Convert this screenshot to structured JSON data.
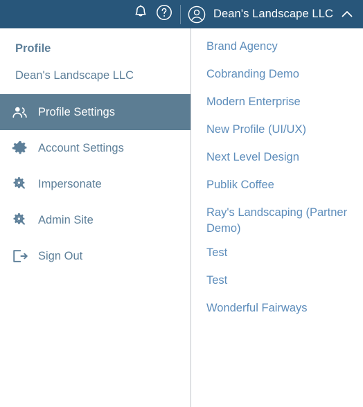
{
  "topbar": {
    "background_color": "#28567a",
    "notifications_icon": "bell-icon",
    "help_icon": "question-circle-icon",
    "avatar_icon": "user-circle-icon",
    "account_name": "Dean's Landscape LLC",
    "chevron_icon": "chevron-up-icon"
  },
  "dropdown": {
    "left_pane": {
      "section_title": "Profile",
      "company_name": "Dean's Landscape LLC",
      "active_color": "#5c7d93",
      "text_color": "#5d7f99",
      "items": [
        {
          "label": "Profile Settings",
          "icon": "users-icon",
          "active": true
        },
        {
          "label": "Account Settings",
          "icon": "gear-icon",
          "active": false
        },
        {
          "label": "Impersonate",
          "icon": "gear-search-icon",
          "active": false
        },
        {
          "label": "Admin Site",
          "icon": "gear-search-icon",
          "active": false
        },
        {
          "label": "Sign Out",
          "icon": "sign-out-icon",
          "active": false
        }
      ]
    },
    "right_pane": {
      "text_color": "#5d8dbb",
      "profiles": [
        {
          "label": "Brand Agency"
        },
        {
          "label": "Cobranding Demo"
        },
        {
          "label": "Modern Enterprise"
        },
        {
          "label": "New Profile (UI/UX)"
        },
        {
          "label": "Next Level Design"
        },
        {
          "label": "Publik Coffee"
        },
        {
          "label": "Ray's Landscaping (Partner Demo)"
        },
        {
          "label": "Test"
        },
        {
          "label": "Test"
        },
        {
          "label": "Wonderful Fairways"
        }
      ]
    }
  }
}
